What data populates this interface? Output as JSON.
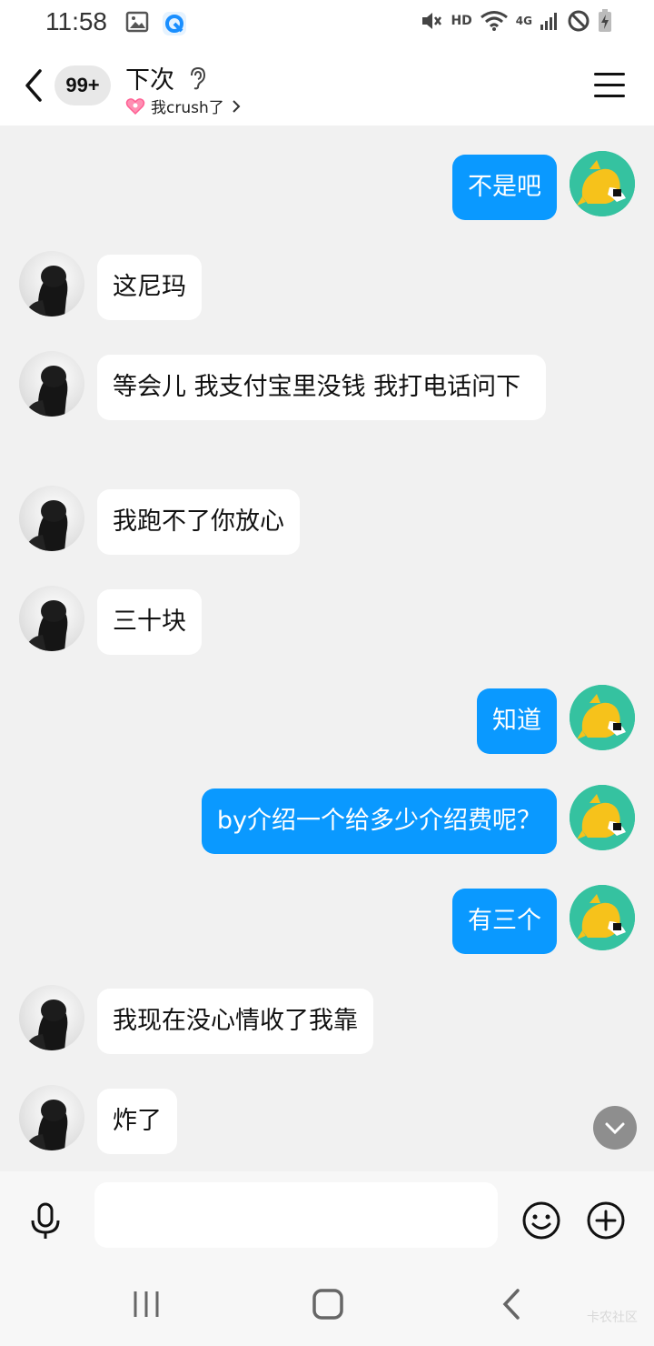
{
  "status_bar": {
    "time": "11:58",
    "network_hd": "HD",
    "network_4g": "4G"
  },
  "header": {
    "unread_count": "99+",
    "contact_name": "下次",
    "relation_tag": "我crush了"
  },
  "messages": [
    {
      "side": "out",
      "text": "不是吧"
    },
    {
      "side": "in",
      "text": "这尼玛"
    },
    {
      "side": "in",
      "text": "等会儿 我支付宝里没钱 我打电话问下"
    },
    {
      "side": "in",
      "text": "我跑不了你放心"
    },
    {
      "side": "in",
      "text": "三十块"
    },
    {
      "side": "out",
      "text": "知道"
    },
    {
      "side": "out",
      "text": "by介绍一个给多少介绍费呢？"
    },
    {
      "side": "out",
      "text": "有三个"
    },
    {
      "side": "in",
      "text": "我现在没心情收了我靠"
    },
    {
      "side": "in",
      "text": "炸了"
    }
  ],
  "composer": {
    "input_value": "",
    "input_placeholder": ""
  },
  "icons": {
    "back": "chevron-left-icon",
    "listen": "ear-icon",
    "menu": "hamburger-menu-icon",
    "mic": "microphone-icon",
    "emoji": "smiley-icon",
    "plus": "plus-circle-icon",
    "scroll": "chevron-down-icon"
  },
  "colors": {
    "outgoing_bubble": "#0a99ff",
    "incoming_bubble": "#ffffff",
    "chat_background": "#f1f1f1",
    "self_avatar_bg": "#35c2a0"
  },
  "watermark": "卡农社区"
}
